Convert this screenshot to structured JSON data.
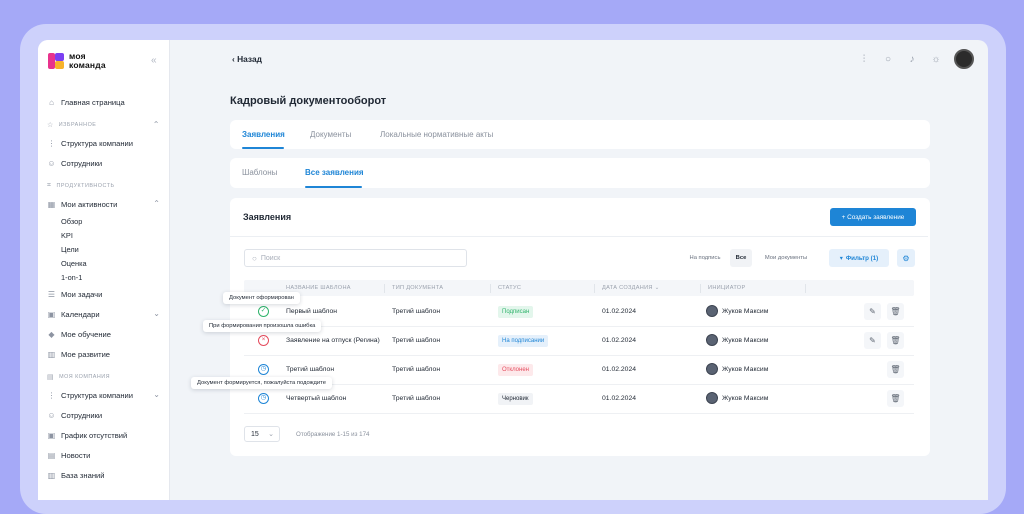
{
  "logo": {
    "line1": "моя",
    "line2": "команда"
  },
  "sidebar": {
    "home": "Главная страница",
    "favorites_title": "ИЗБРАННОЕ",
    "favorites": [
      "Структура компании",
      "Сотрудники"
    ],
    "productivity_title": "ПРОДУКТИВНОСТЬ",
    "activities": "Мои активности",
    "activities_sub": [
      "Обзор",
      "KPI",
      "Цели",
      "Оценка",
      "1-on-1"
    ],
    "tasks": "Мои задачи",
    "calendars": "Календари",
    "learning": "Мое обучение",
    "development": "Мое развитие",
    "company_title": "МОЯ КОМПАНИЯ",
    "company": [
      "Структура компании",
      "Сотрудники",
      "График отсутствий",
      "Новости",
      "База знаний"
    ]
  },
  "topbar": {
    "back_label": "Назад"
  },
  "page": {
    "title": "Кадровый документооборот"
  },
  "tabs": [
    "Заявления",
    "Документы",
    "Локальные нормативные акты"
  ],
  "subtabs": [
    "Шаблоны",
    "Все заявления"
  ],
  "main": {
    "title": "Заявления",
    "create_label": "+ Создать заявление",
    "search_placeholder": "Поиск",
    "segments": [
      "На подпись",
      "Все",
      "Мои документы"
    ],
    "filter_label": "Фильтр (1)"
  },
  "table": {
    "headers": [
      "НАЗВАНИЕ ШАБЛОНА",
      "ТИП ДОКУМЕНТА",
      "СТАТУС",
      "ДАТА СОЗДАНИЯ",
      "ИНИЦИАТОР"
    ],
    "rows": [
      {
        "name": "Первый шаблон",
        "type": "Третий шаблон",
        "status": "Подписан",
        "date": "01.02.2024",
        "initiator": "Жуков Максим"
      },
      {
        "name": "Заявление на отпуск (Регина)",
        "type": "Третий шаблон",
        "status": "На подписании",
        "date": "01.02.2024",
        "initiator": "Жуков Максим"
      },
      {
        "name": "Третий шаблон",
        "type": "Третий шаблон",
        "status": "Отклонен",
        "date": "01.02.2024",
        "initiator": "Жуков Максим"
      },
      {
        "name": "Четвертый шаблон",
        "type": "Третий шаблон",
        "status": "Черновик",
        "date": "01.02.2024",
        "initiator": "Жуков Максим"
      }
    ]
  },
  "pager": {
    "page_size": "15",
    "range_text": "Отображение 1-15 из 174"
  },
  "tooltips": [
    "Документ оформирован",
    "При формирования произошла ошибка",
    "Документ формируется, пожалуйста подождите"
  ],
  "colors": {
    "accent": "#1e85d6",
    "success": "#2fb36b",
    "error": "#e54c5e",
    "pending": "#1e85d6"
  }
}
